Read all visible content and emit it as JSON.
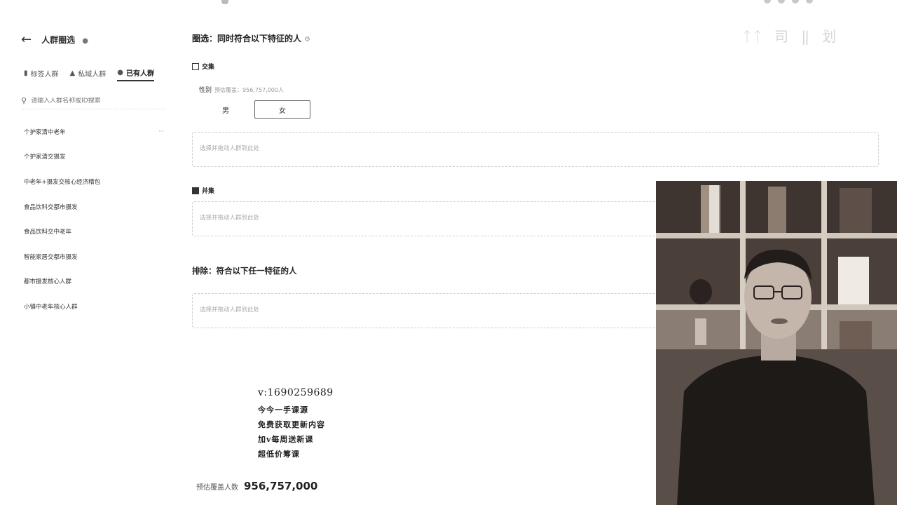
{
  "watermark": "ᛏᛏ 司 ‖ 划",
  "sidebar": {
    "title": "人群圈选",
    "tabs": [
      {
        "label": "标签人群",
        "icon": "tag-icon",
        "active": false
      },
      {
        "label": "私域人群",
        "icon": "house-icon",
        "active": false
      },
      {
        "label": "已有人群",
        "icon": "person-icon",
        "active": true
      }
    ],
    "search_placeholder": "请输入人群名称或ID搜索",
    "items": [
      {
        "label": "个护家清中老年",
        "more": "···"
      },
      {
        "label": "个护家清交摄发"
      },
      {
        "label": "中老年+摄发交核心经济精包"
      },
      {
        "label": "食品饮料交都市摄发"
      },
      {
        "label": "食品饮料交中老年"
      },
      {
        "label": "智能家居交都市摄发"
      },
      {
        "label": "都市摄发核心人群"
      },
      {
        "label": "小镇中老年核心人群"
      }
    ]
  },
  "main": {
    "select_title": "圈选：同时符合以下特征的人",
    "intersect_label": "交集",
    "gender": {
      "label": "性别",
      "hint": "预估覆盖：956,757,000人",
      "options": [
        "男",
        "女"
      ],
      "selected": "女"
    },
    "placeholder": "选择并拖动人群到此处",
    "union_label": "并集",
    "exclude_title": "排除：符合以下任一特征的人"
  },
  "promo": {
    "v": "v:1690259689",
    "lines": [
      "今今一手课源",
      "免费获取更新内容",
      "加v每周送新课",
      "超低价筹课"
    ]
  },
  "estimate": {
    "label": "预估覆盖人数",
    "value": "956,757,000"
  }
}
